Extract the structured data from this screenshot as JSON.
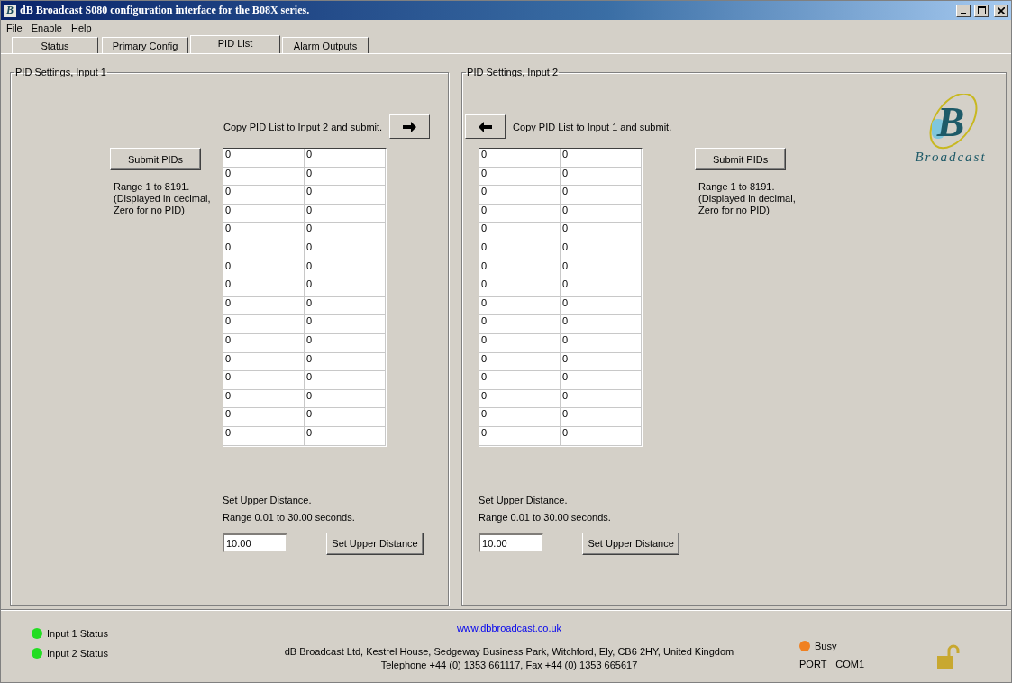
{
  "window": {
    "icon_letter": "B",
    "title": "dB Broadcast S080 configuration interface for the B08X series."
  },
  "menu": [
    "File",
    "Enable",
    "Help"
  ],
  "tabs": [
    {
      "label": "Status",
      "selected": false
    },
    {
      "label": "Primary Config",
      "selected": false
    },
    {
      "label": "PID List",
      "selected": true
    },
    {
      "label": "Alarm Outputs",
      "selected": false
    }
  ],
  "inputs": [
    {
      "title": "PID Settings, Input 1",
      "arrow_points_right": true,
      "copy_text": "Copy PID List to Input 2 and submit.",
      "submit_button": "Submit PIDs",
      "note": [
        "Range 1 to 8191.",
        "(Displayed in decimal,",
        "Zero for no PID)"
      ],
      "pids": [
        [
          "0",
          "0"
        ],
        [
          "0",
          "0"
        ],
        [
          "0",
          "0"
        ],
        [
          "0",
          "0"
        ],
        [
          "0",
          "0"
        ],
        [
          "0",
          "0"
        ],
        [
          "0",
          "0"
        ],
        [
          "0",
          "0"
        ],
        [
          "0",
          "0"
        ],
        [
          "0",
          "0"
        ],
        [
          "0",
          "0"
        ],
        [
          "0",
          "0"
        ],
        [
          "0",
          "0"
        ],
        [
          "0",
          "0"
        ],
        [
          "0",
          "0"
        ],
        [
          "0",
          "0"
        ]
      ],
      "distance_note": [
        "Set Upper Distance.",
        "Range 0.01 to 30.00 seconds."
      ],
      "distance_value": "10.00",
      "distance_button": "Set Upper Distance"
    },
    {
      "title": "PID Settings, Input 2",
      "arrow_points_right": false,
      "copy_text": "Copy PID List to Input 1 and submit.",
      "submit_button": "Submit PIDs",
      "note": [
        "Range 1 to 8191.",
        "(Displayed in decimal,",
        "Zero for no PID)"
      ],
      "pids": [
        [
          "0",
          "0"
        ],
        [
          "0",
          "0"
        ],
        [
          "0",
          "0"
        ],
        [
          "0",
          "0"
        ],
        [
          "0",
          "0"
        ],
        [
          "0",
          "0"
        ],
        [
          "0",
          "0"
        ],
        [
          "0",
          "0"
        ],
        [
          "0",
          "0"
        ],
        [
          "0",
          "0"
        ],
        [
          "0",
          "0"
        ],
        [
          "0",
          "0"
        ],
        [
          "0",
          "0"
        ],
        [
          "0",
          "0"
        ],
        [
          "0",
          "0"
        ],
        [
          "0",
          "0"
        ]
      ],
      "distance_note": [
        "Set Upper Distance.",
        "Range 0.01 to 30.00 seconds."
      ],
      "distance_value": "10.00",
      "distance_button": "Set Upper Distance"
    }
  ],
  "logo": {
    "mark": "B",
    "wordmark": "Broadcast"
  },
  "status_bar": {
    "statuses": [
      {
        "label": "Input 1 Status",
        "color": "#22dd22"
      },
      {
        "label": "Input 2 Status",
        "color": "#22dd22"
      }
    ],
    "link": "www.dbbroadcast.co.uk",
    "address": [
      "dB Broadcast Ltd, Kestrel House, Sedgeway Business Park, Witchford, Ely, CB6 2HY, United Kingdom",
      "Telephone +44 (0) 1353 661117, Fax +44 (0) 1353 665617"
    ],
    "busy": {
      "label": "Busy",
      "color": "#f08020"
    },
    "port_label": "PORT",
    "port": "COM1",
    "locked": false
  }
}
